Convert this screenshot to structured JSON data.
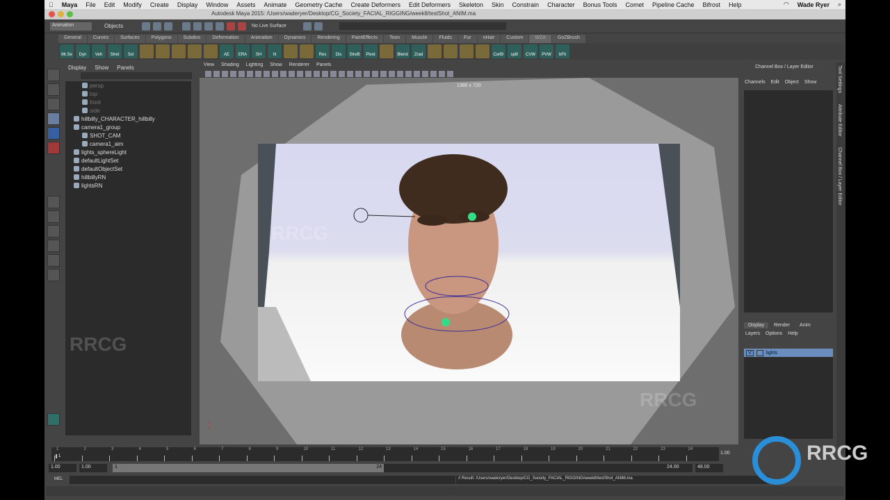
{
  "mac_menu": [
    "Maya",
    "File",
    "Edit",
    "Modify",
    "Create",
    "Display",
    "Window",
    "Assets",
    "Animate",
    "Geometry Cache",
    "Create Deformers",
    "Edit Deformers",
    "Skeleton",
    "Skin",
    "Constrain",
    "Character",
    "Bonus Tools",
    "Comet",
    "Pipeline Cache",
    "Bifrost",
    "Help"
  ],
  "user": "Wade Ryer",
  "window_title": "Autodesk Maya 2015: /Users/waderyer/Desktop/CG_Society_FACIAL_RIGGING/week8/testShot_ANIM.ma",
  "status": {
    "mode": "Animation",
    "selection": "Objects",
    "live_surface": "No Live Surface"
  },
  "shelf_tabs": [
    "General",
    "Curves",
    "Surfaces",
    "Polygons",
    "Subdivs",
    "Deformation",
    "Animation",
    "Dynamics",
    "Rendering",
    "PaintEffects",
    "Toon",
    "Muscle",
    "Fluids",
    "Fur",
    "nHair",
    "Custom",
    "WZA",
    "GoZBrush"
  ],
  "active_shelf": "WZA",
  "shelf_buttons": [
    "Mr.Se",
    "Dyn",
    "Veh",
    "Stret",
    "Scl",
    "",
    "",
    "",
    "",
    "",
    "AE",
    "ERA",
    "SH",
    "hl",
    "",
    "",
    "Res",
    "Dis",
    "StreB",
    "Pivot",
    "",
    "Blend",
    "Zrad",
    "",
    "",
    "",
    "",
    "CorB!",
    "splt!",
    "CVW",
    "PVW",
    "bFit"
  ],
  "outliner": {
    "menu": [
      "Display",
      "Show",
      "Panels"
    ],
    "items": [
      {
        "label": "persp",
        "indent": 1,
        "dim": true
      },
      {
        "label": "top",
        "indent": 1,
        "dim": true
      },
      {
        "label": "front",
        "indent": 1,
        "dim": true
      },
      {
        "label": "side",
        "indent": 1,
        "dim": true
      },
      {
        "label": "hillbilly_CHARACTER_hillbilly",
        "indent": 0
      },
      {
        "label": "camera1_group",
        "indent": 0
      },
      {
        "label": "SHOT_CAM",
        "indent": 1
      },
      {
        "label": "camera1_aim",
        "indent": 1
      },
      {
        "label": "lights_sphereLight",
        "indent": 0
      },
      {
        "label": "defaultLightSet",
        "indent": 0
      },
      {
        "label": "defaultObjectSet",
        "indent": 0
      },
      {
        "label": "hillbillyRN",
        "indent": 0
      },
      {
        "label": "lightsRN",
        "indent": 0
      }
    ]
  },
  "viewport": {
    "menu": [
      "View",
      "Shading",
      "Lighting",
      "Show",
      "Renderer",
      "Panels"
    ],
    "resolution": "1380 x 720"
  },
  "channel_box": {
    "title": "Channel Box / Layer Editor",
    "menu": [
      "Channels",
      "Edit",
      "Object",
      "Show"
    ]
  },
  "side_tabs": [
    "Tool Settings",
    "Attribute Editor",
    "Channel Box / Layer Editor"
  ],
  "layers": {
    "tabs": [
      "Display",
      "Render",
      "Anim"
    ],
    "menu": [
      "Layers",
      "Options",
      "Help"
    ],
    "items": [
      {
        "visible": "V",
        "name": "lights"
      }
    ]
  },
  "timeline": {
    "ticks": [
      "1",
      "2",
      "3",
      "4",
      "5",
      "6",
      "7",
      "8",
      "9",
      "10",
      "11",
      "12",
      "13",
      "14",
      "15",
      "16",
      "17",
      "18",
      "19",
      "20",
      "21",
      "22",
      "23",
      "24"
    ],
    "current": "1.00",
    "current_marker": "1"
  },
  "range": {
    "start": "1.00",
    "playback_start": "1.00",
    "slider_start": "1",
    "slider_end": "24",
    "playback_end": "24.00",
    "end": "48.00"
  },
  "command": {
    "label": "MEL",
    "result": "// Result: /Users/waderyer/Desktop/CG_Society_FACIAL_RIGGING/week8/testShot_ANIM.ma"
  },
  "watermark": "RRCG",
  "colors": {
    "accent_teal": "#2f6f68",
    "layer_sel": "#6a8fbf"
  }
}
